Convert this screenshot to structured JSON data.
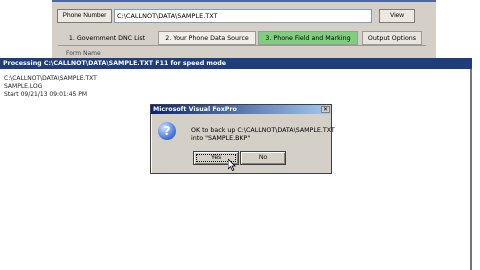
{
  "background_window": {
    "phone_number_button": "Phone Number",
    "path_value": "C:\\CALLNOT\\DATA\\SAMPLE.TXT",
    "view_button": "View",
    "tabs": [
      {
        "label": "1. Government  DNC List"
      },
      {
        "label": "2. Your Phone Data Source"
      },
      {
        "label": "3. Phone Field and Marking"
      },
      {
        "label": "Output Options"
      }
    ],
    "form_name_label": "Form Name"
  },
  "processing_window": {
    "title": "Processing C:\\CALLNOT\\DATA\\SAMPLE.TXT    F11 for speed mode",
    "log_lines": [
      "C:\\CALLNOT\\DATA\\SAMPLE.TXT",
      "SAMPLE.LOG",
      "Start    09/21/13 09:01:45 PM"
    ]
  },
  "dialog": {
    "title": "Microsoft Visual FoxPro",
    "close_glyph": "✕",
    "icon": "question-icon",
    "message_line_1": "OK to back up C:\\CALLNOT\\DATA\\SAMPLE.TXT",
    "message_line_2": "into \"SAMPLE.BKP\"",
    "yes_label": "Yes",
    "no_label": "No"
  },
  "colors": {
    "processing_titlebar": "#1f3d7a",
    "dialog_titlebar_start": "#0a246a",
    "active_tab": "#7fcf7f"
  }
}
